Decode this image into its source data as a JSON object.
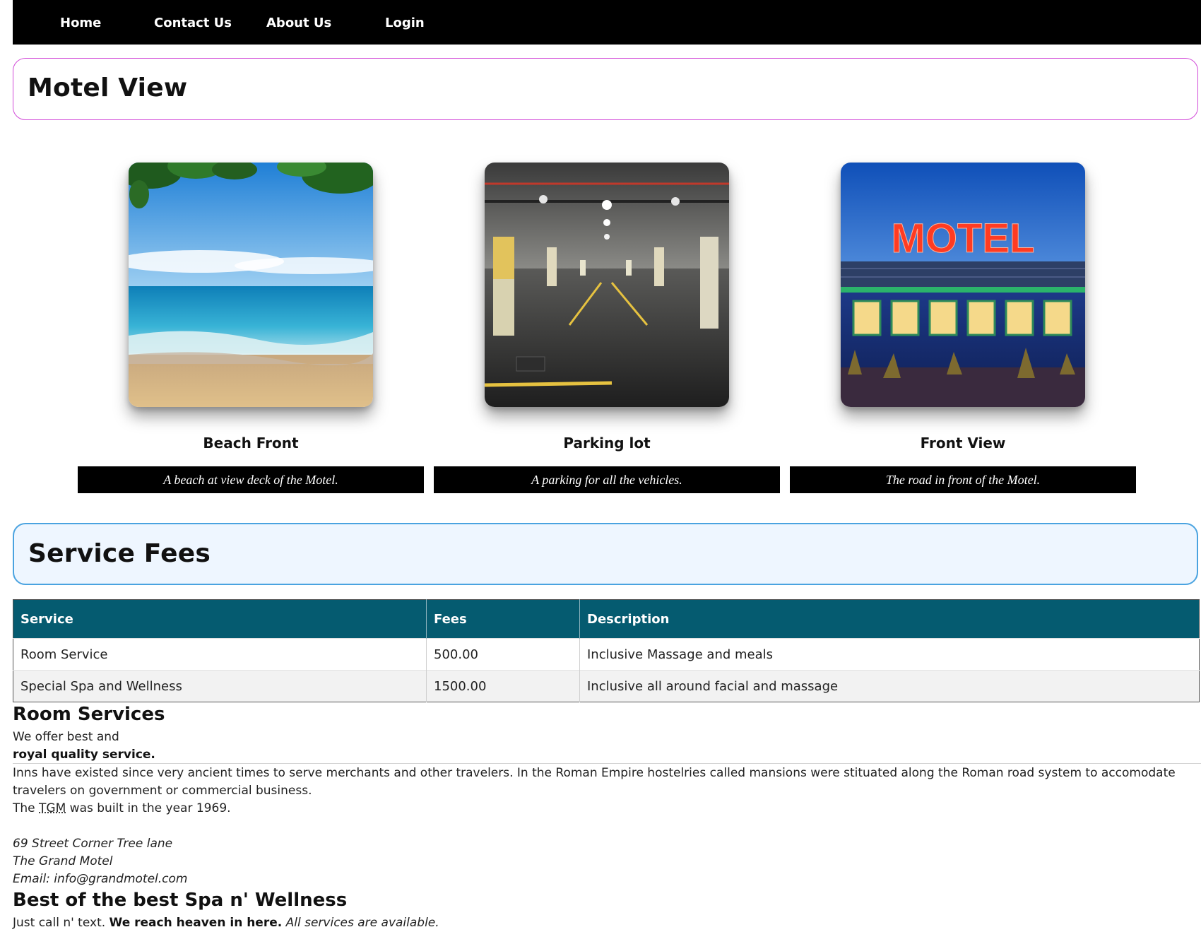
{
  "nav": {
    "home": "Home",
    "contact": "Contact Us",
    "about": "About Us",
    "login": "Login"
  },
  "motel_view": {
    "title": "Motel View",
    "cards": [
      {
        "title": "Beach Front",
        "caption": "A beach at view deck of the Motel.",
        "image": "beach-photo"
      },
      {
        "title": "Parking lot",
        "caption": "A parking for all the vehicles.",
        "image": "parking-photo"
      },
      {
        "title": "Front View",
        "caption": "The road in front of the Motel.",
        "image": "motel-front-photo",
        "sign_text": "MOTEL"
      }
    ]
  },
  "service_fees": {
    "title": "Service Fees",
    "headers": [
      "Service",
      "Fees",
      "Description"
    ],
    "rows": [
      [
        "Room Service",
        "500.00",
        "Inclusive Massage and meals"
      ],
      [
        "Special Spa and Wellness",
        "1500.00",
        "Inclusive all around facial and massage"
      ]
    ]
  },
  "room_services": {
    "title": "Room Services",
    "line1": "We offer best and",
    "line2": "royal quality service.",
    "history": "Inns have existed since very ancient times to serve merchants and other travelers. In the Roman Empire hostelries called mansions were stituated along the Roman road system to accomodate travelers on government or commercial business.",
    "built_prefix": "The",
    "built_abbr": "TGM",
    "built_suffix": "was built in the year 1969.",
    "address": [
      "69 Street Corner Tree lane",
      "The Grand Motel",
      "Email: info@grandmotel.com"
    ]
  },
  "spa": {
    "title": "Best of the best Spa n' Wellness",
    "plain": "Just call n' text.",
    "bold": "We reach heaven in here.",
    "italic": "All services are available."
  }
}
